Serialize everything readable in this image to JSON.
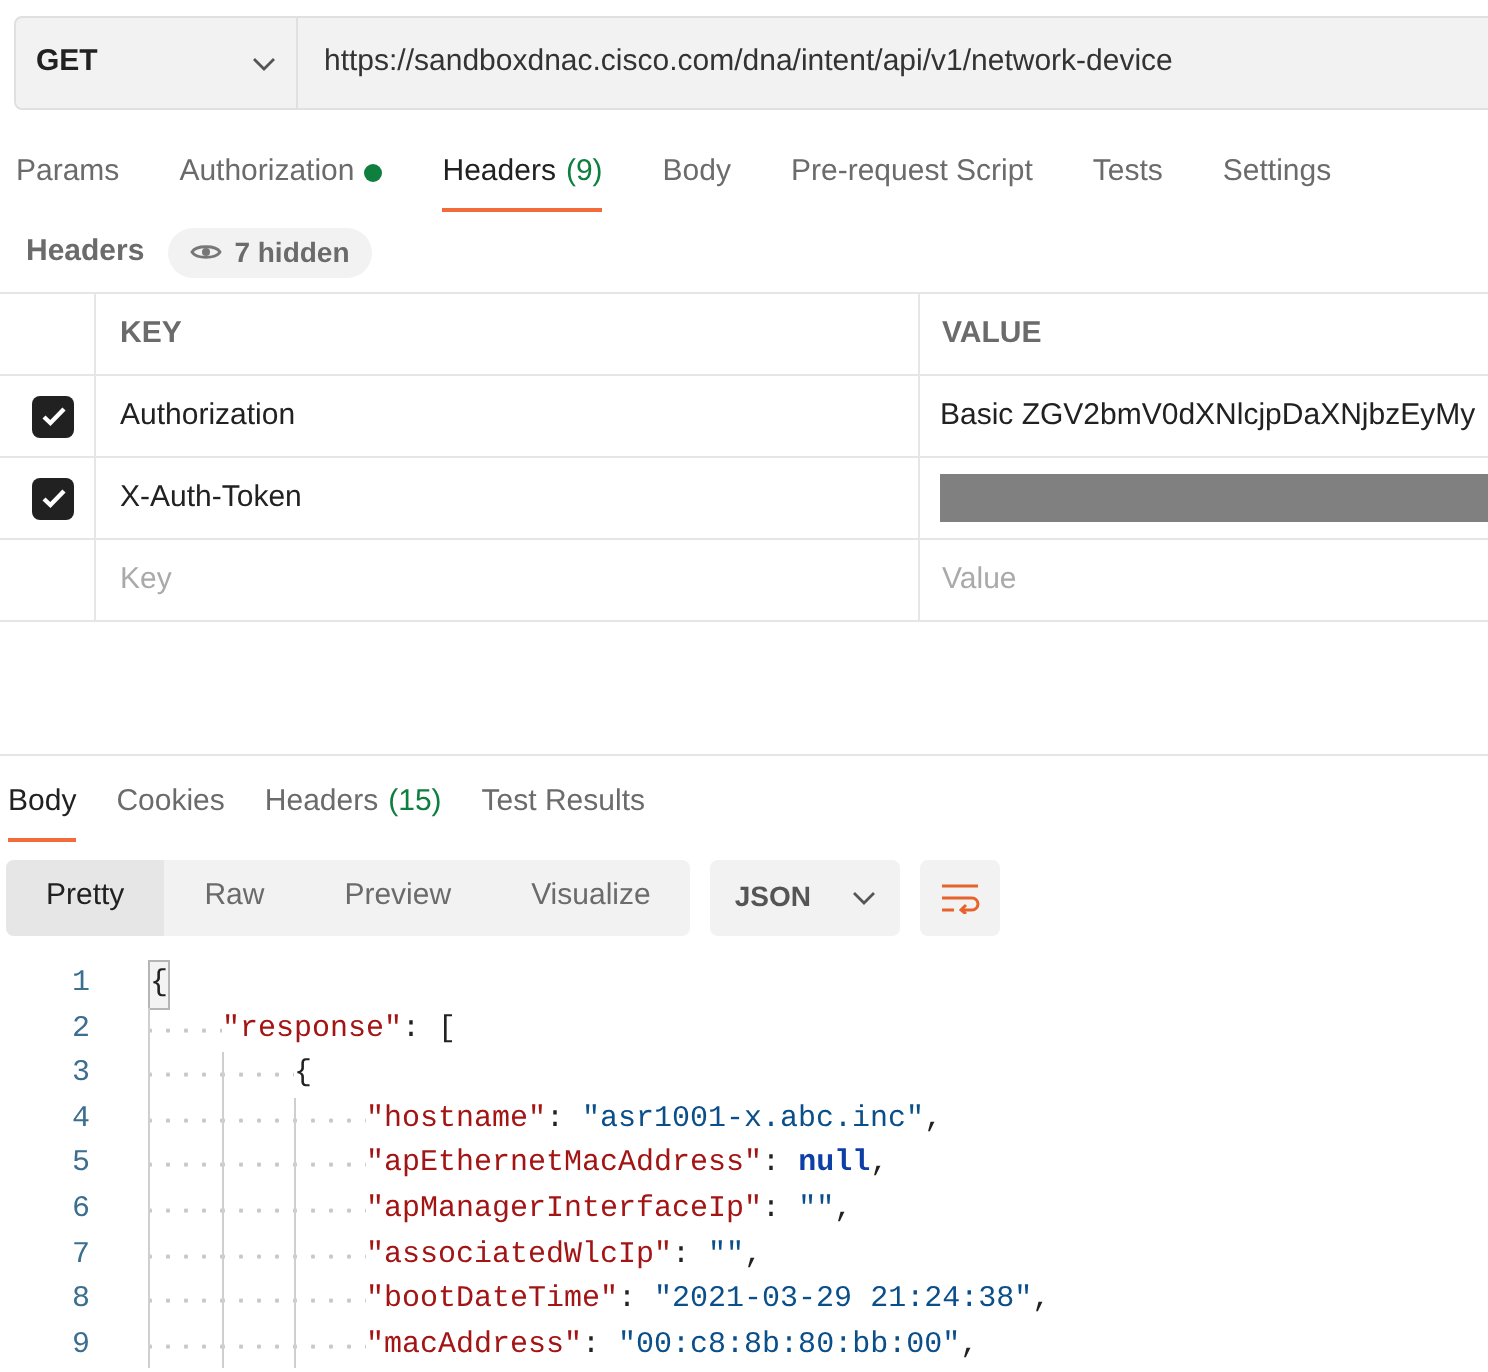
{
  "request": {
    "method": "GET",
    "url": "https://sandboxdnac.cisco.com/dna/intent/api/v1/network-device"
  },
  "request_tabs": [
    {
      "label": "Params",
      "selected": false,
      "has_dot": false
    },
    {
      "label": "Authorization",
      "selected": false,
      "has_dot": true
    },
    {
      "label": "Headers",
      "count": "(9)",
      "selected": true,
      "has_dot": false
    },
    {
      "label": "Body",
      "selected": false,
      "has_dot": false
    },
    {
      "label": "Pre-request Script",
      "selected": false,
      "has_dot": false
    },
    {
      "label": "Tests",
      "selected": false,
      "has_dot": false
    },
    {
      "label": "Settings",
      "selected": false,
      "has_dot": false
    }
  ],
  "headers_section": {
    "title": "Headers",
    "hidden_toggle": "7 hidden"
  },
  "headers_table": {
    "columns": [
      "KEY",
      "VALUE"
    ],
    "rows": [
      {
        "checked": true,
        "key": "Authorization",
        "value": "Basic ZGV2bmV0dXNlcjpDaXNjbzEyMy",
        "redacted": false
      },
      {
        "checked": true,
        "key": "X-Auth-Token",
        "redacted": true
      }
    ],
    "new_row": {
      "key_placeholder": "Key",
      "value_placeholder": "Value"
    }
  },
  "response_tabs": [
    {
      "label": "Body",
      "selected": true
    },
    {
      "label": "Cookies",
      "selected": false
    },
    {
      "label": "Headers",
      "count": "(15)",
      "selected": false
    },
    {
      "label": "Test Results",
      "selected": false
    }
  ],
  "view_modes": [
    {
      "label": "Pretty",
      "selected": true
    },
    {
      "label": "Raw",
      "selected": false
    },
    {
      "label": "Preview",
      "selected": false
    },
    {
      "label": "Visualize",
      "selected": false
    }
  ],
  "format": "JSON",
  "wrap_lines": {
    "on": true
  },
  "code": [
    {
      "number": "1",
      "tokens": [
        {
          "kind": "bracket",
          "text": "{"
        }
      ]
    },
    {
      "number": "2",
      "tokens": [
        {
          "kind": "indent"
        },
        {
          "kind": "key",
          "text": "\"response\""
        },
        {
          "kind": "punct",
          "text": ": ["
        }
      ]
    },
    {
      "number": "3",
      "tokens": [
        {
          "kind": "indent"
        },
        {
          "kind": "indent"
        },
        {
          "kind": "punct",
          "text": "{"
        }
      ]
    },
    {
      "number": "4",
      "tokens": [
        {
          "kind": "indent"
        },
        {
          "kind": "indent"
        },
        {
          "kind": "indent"
        },
        {
          "kind": "key",
          "text": "\"hostname\""
        },
        {
          "kind": "punct",
          "text": ": "
        },
        {
          "kind": "string",
          "text": "\"asr1001-x.abc.inc\""
        },
        {
          "kind": "punct",
          "text": ","
        }
      ]
    },
    {
      "number": "5",
      "tokens": [
        {
          "kind": "indent"
        },
        {
          "kind": "indent"
        },
        {
          "kind": "indent"
        },
        {
          "kind": "key",
          "text": "\"apEthernetMacAddress\""
        },
        {
          "kind": "punct",
          "text": ": "
        },
        {
          "kind": "null",
          "text": "null"
        },
        {
          "kind": "punct",
          "text": ","
        }
      ]
    },
    {
      "number": "6",
      "tokens": [
        {
          "kind": "indent"
        },
        {
          "kind": "indent"
        },
        {
          "kind": "indent"
        },
        {
          "kind": "key",
          "text": "\"apManagerInterfaceIp\""
        },
        {
          "kind": "punct",
          "text": ": "
        },
        {
          "kind": "string",
          "text": "\"\""
        },
        {
          "kind": "punct",
          "text": ","
        }
      ]
    },
    {
      "number": "7",
      "tokens": [
        {
          "kind": "indent"
        },
        {
          "kind": "indent"
        },
        {
          "kind": "indent"
        },
        {
          "kind": "key",
          "text": "\"associatedWlcIp\""
        },
        {
          "kind": "punct",
          "text": ": "
        },
        {
          "kind": "string",
          "text": "\"\""
        },
        {
          "kind": "punct",
          "text": ","
        }
      ]
    },
    {
      "number": "8",
      "tokens": [
        {
          "kind": "indent"
        },
        {
          "kind": "indent"
        },
        {
          "kind": "indent"
        },
        {
          "kind": "key",
          "text": "\"bootDateTime\""
        },
        {
          "kind": "punct",
          "text": ": "
        },
        {
          "kind": "string",
          "text": "\"2021-03-29 21:24:38\""
        },
        {
          "kind": "punct",
          "text": ","
        }
      ]
    },
    {
      "number": "9",
      "tokens": [
        {
          "kind": "indent"
        },
        {
          "kind": "indent"
        },
        {
          "kind": "indent"
        },
        {
          "kind": "key",
          "text": "\"macAddress\""
        },
        {
          "kind": "punct",
          "text": ": "
        },
        {
          "kind": "string",
          "text": "\"00:c8:8b:80:bb:00\""
        },
        {
          "kind": "punct",
          "text": ","
        }
      ]
    }
  ]
}
